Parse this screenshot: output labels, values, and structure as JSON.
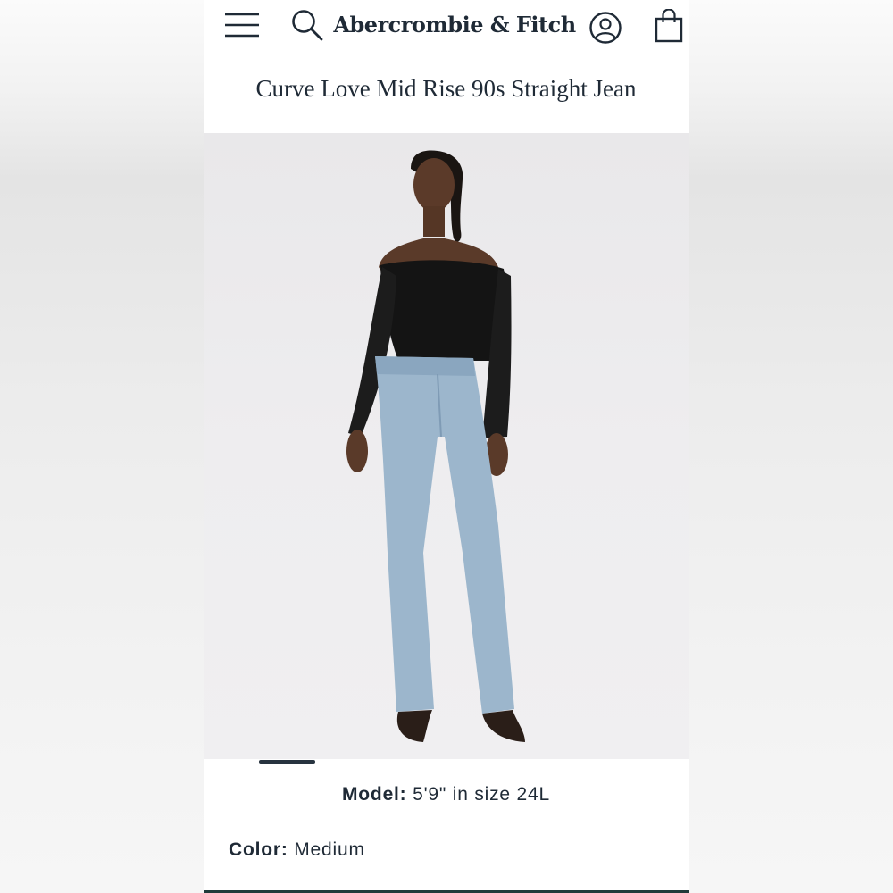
{
  "header": {
    "brand": "Abercrombie & Fitch",
    "icons": {
      "menu": "hamburger-menu-icon",
      "search": "search-icon",
      "account": "account-icon",
      "bag": "shopping-bag-icon"
    }
  },
  "product": {
    "title": "Curve Love Mid Rise 90s Straight Jean",
    "image_alt": "Model wearing off-shoulder black mesh top and light wash straight jeans",
    "carousel": {
      "current_index": 1
    },
    "model": {
      "label": "Model:",
      "value": "5'9\" in size 24L"
    },
    "color": {
      "label": "Color:",
      "value": "Medium"
    }
  },
  "colors": {
    "text": "#1f2a36",
    "image_background": "#eceaec",
    "denim": "#9cb6cc",
    "top": "#111111",
    "accent_rule": "#1f3b3a"
  }
}
